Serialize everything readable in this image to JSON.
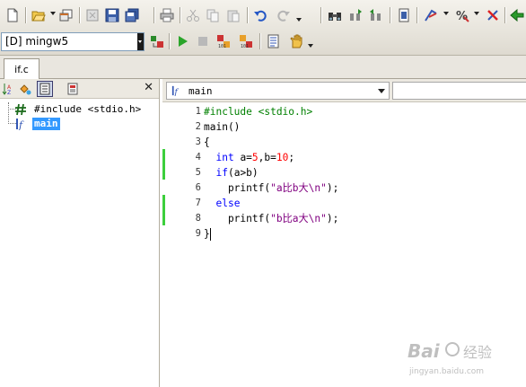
{
  "toolbar": {
    "compiler": "[D] mingw5"
  },
  "tabs": [
    {
      "label": "if.c"
    }
  ],
  "class_browser": {
    "close_glyph": "✕",
    "items": [
      {
        "icon": "include-icon",
        "label": "#include <stdio.h>"
      },
      {
        "icon": "function-icon",
        "label": "main",
        "selected": true
      }
    ]
  },
  "editor": {
    "function_selector": "main",
    "lines": [
      {
        "no": "1",
        "text": "#include <stdio.h>"
      },
      {
        "no": "2",
        "text": "main()"
      },
      {
        "no": "3",
        "text": "{"
      },
      {
        "no": "4",
        "text": "  int a=5,b=10;"
      },
      {
        "no": "5",
        "text": "  if(a>b)"
      },
      {
        "no": "6",
        "text": "    printf(\"a比b大\\n\");"
      },
      {
        "no": "7",
        "text": "  else"
      },
      {
        "no": "8",
        "text": "    printf(\"b比a大\\n\");"
      },
      {
        "no": "9",
        "text": "}"
      }
    ]
  },
  "colors": {
    "keyword": "#0000ff",
    "preprocessor": "#008000",
    "number": "#ff0000",
    "string": "#800080",
    "changed_line_marker": "#3ccf3c",
    "selection": "#3399ff"
  },
  "watermark": {
    "text": "Baidu 经验",
    "url": "jingyan.baidu.com"
  }
}
